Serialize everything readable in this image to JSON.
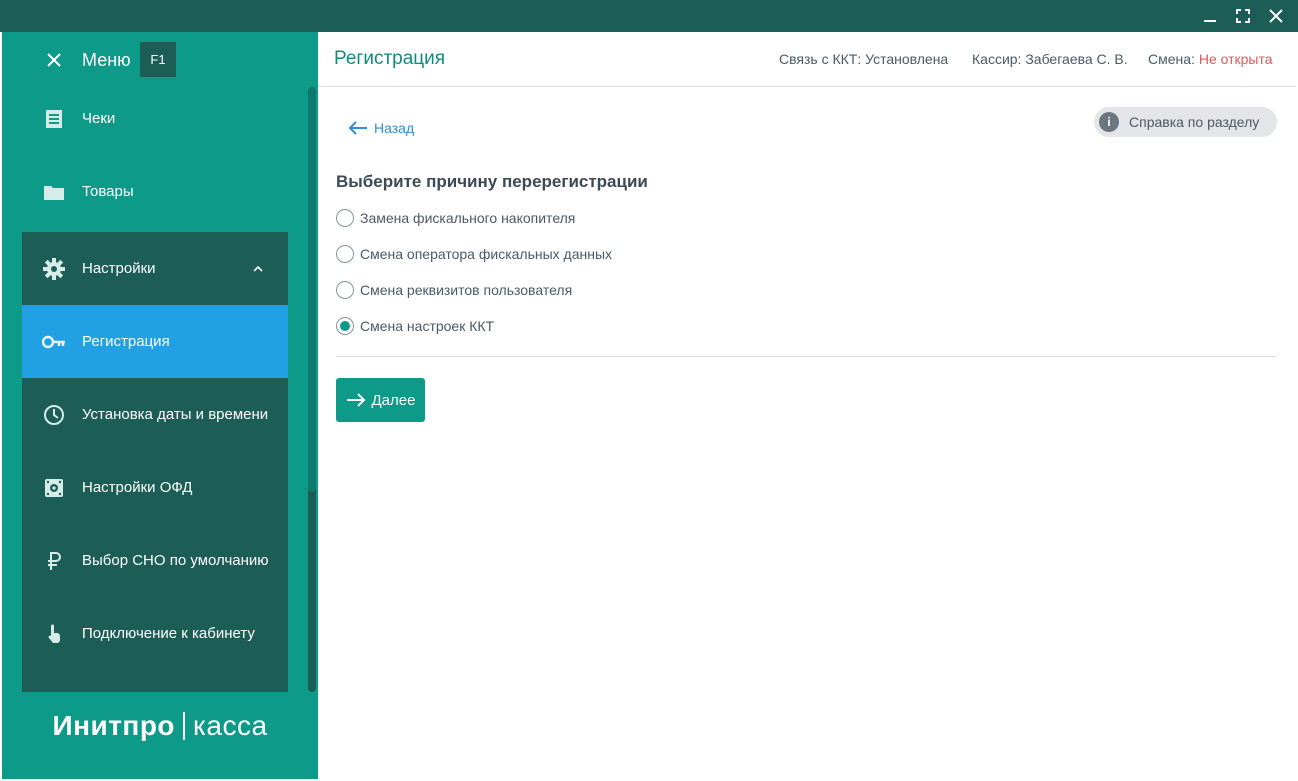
{
  "window": {
    "minimize_icon": "minimize-icon",
    "maximize_icon": "maximize-icon",
    "close_icon": "close-icon"
  },
  "sidebar": {
    "menu_label": "Меню",
    "menu_key": "F1",
    "items": [
      {
        "label": "Чеки",
        "icon": "receipt-icon"
      },
      {
        "label": "Товары",
        "icon": "folder-icon"
      }
    ],
    "settings": {
      "label": "Настройки",
      "icon": "gear-icon",
      "children": [
        {
          "label": "Регистрация",
          "icon": "key-icon",
          "active": true
        },
        {
          "label": "Установка даты и времени",
          "icon": "clock-icon"
        },
        {
          "label": "Настройки ОФД",
          "icon": "ofd-icon"
        },
        {
          "label": "Выбор СНО по умолчанию",
          "icon": "ruble-icon"
        },
        {
          "label": "Подключение к кабинету",
          "icon": "touch-icon"
        }
      ]
    },
    "brand": {
      "bold": "Инитпро",
      "light": "касса"
    }
  },
  "header": {
    "title": "Регистрация",
    "connection": "Связь с ККТ: Установлена",
    "cashier": "Кассир: Забегаева С. В.",
    "shift_label": "Смена:",
    "shift_value": "Не открыта"
  },
  "content": {
    "back_label": "Назад",
    "help_label": "Справка по разделу",
    "question": "Выберите причину перерегистрации",
    "options": [
      {
        "label": "Замена фискального накопителя",
        "checked": false
      },
      {
        "label": "Смена оператора фискальных данных",
        "checked": false
      },
      {
        "label": "Смена реквизитов пользователя",
        "checked": false
      },
      {
        "label": "Смена настроек ККТ",
        "checked": true
      }
    ],
    "next_label": "Далее"
  },
  "colors": {
    "sidebar": "#0e9a89",
    "sidebar_dark": "#1c5e56",
    "active": "#21a1e3",
    "accent": "#118b7c",
    "alert": "#e05a5a"
  }
}
